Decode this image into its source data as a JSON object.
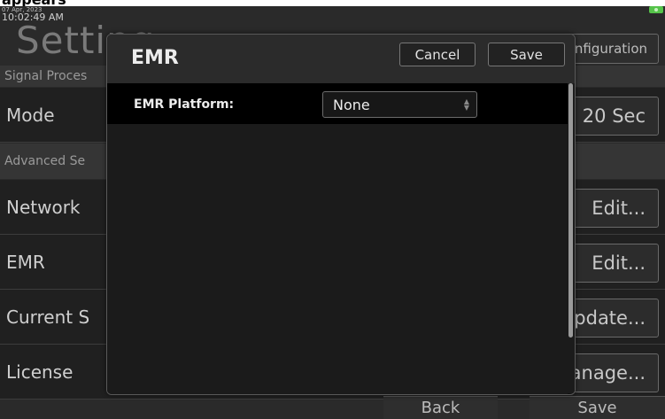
{
  "caption_fragment": "appears",
  "status": {
    "date": "07 Apr, 2023",
    "time": "10:02:49 AM"
  },
  "page": {
    "title": "Setting"
  },
  "top_right_button": "nfiguration",
  "sections": {
    "signal": "Signal Proces",
    "advanced": "Advanced Se"
  },
  "rows": {
    "mode": {
      "label": "Mode",
      "value": "20 Sec"
    },
    "network": {
      "label": "Network",
      "button": "Edit..."
    },
    "emr": {
      "label": "EMR",
      "button": "Edit..."
    },
    "current": {
      "label": "Current S",
      "button": "pdate..."
    },
    "license": {
      "label": "License",
      "button": "anage..."
    }
  },
  "bottom": {
    "back": "Back",
    "save": "Save"
  },
  "modal": {
    "title": "EMR",
    "cancel": "Cancel",
    "save": "Save",
    "field_label": "EMR Platform:",
    "field_value": "None"
  }
}
